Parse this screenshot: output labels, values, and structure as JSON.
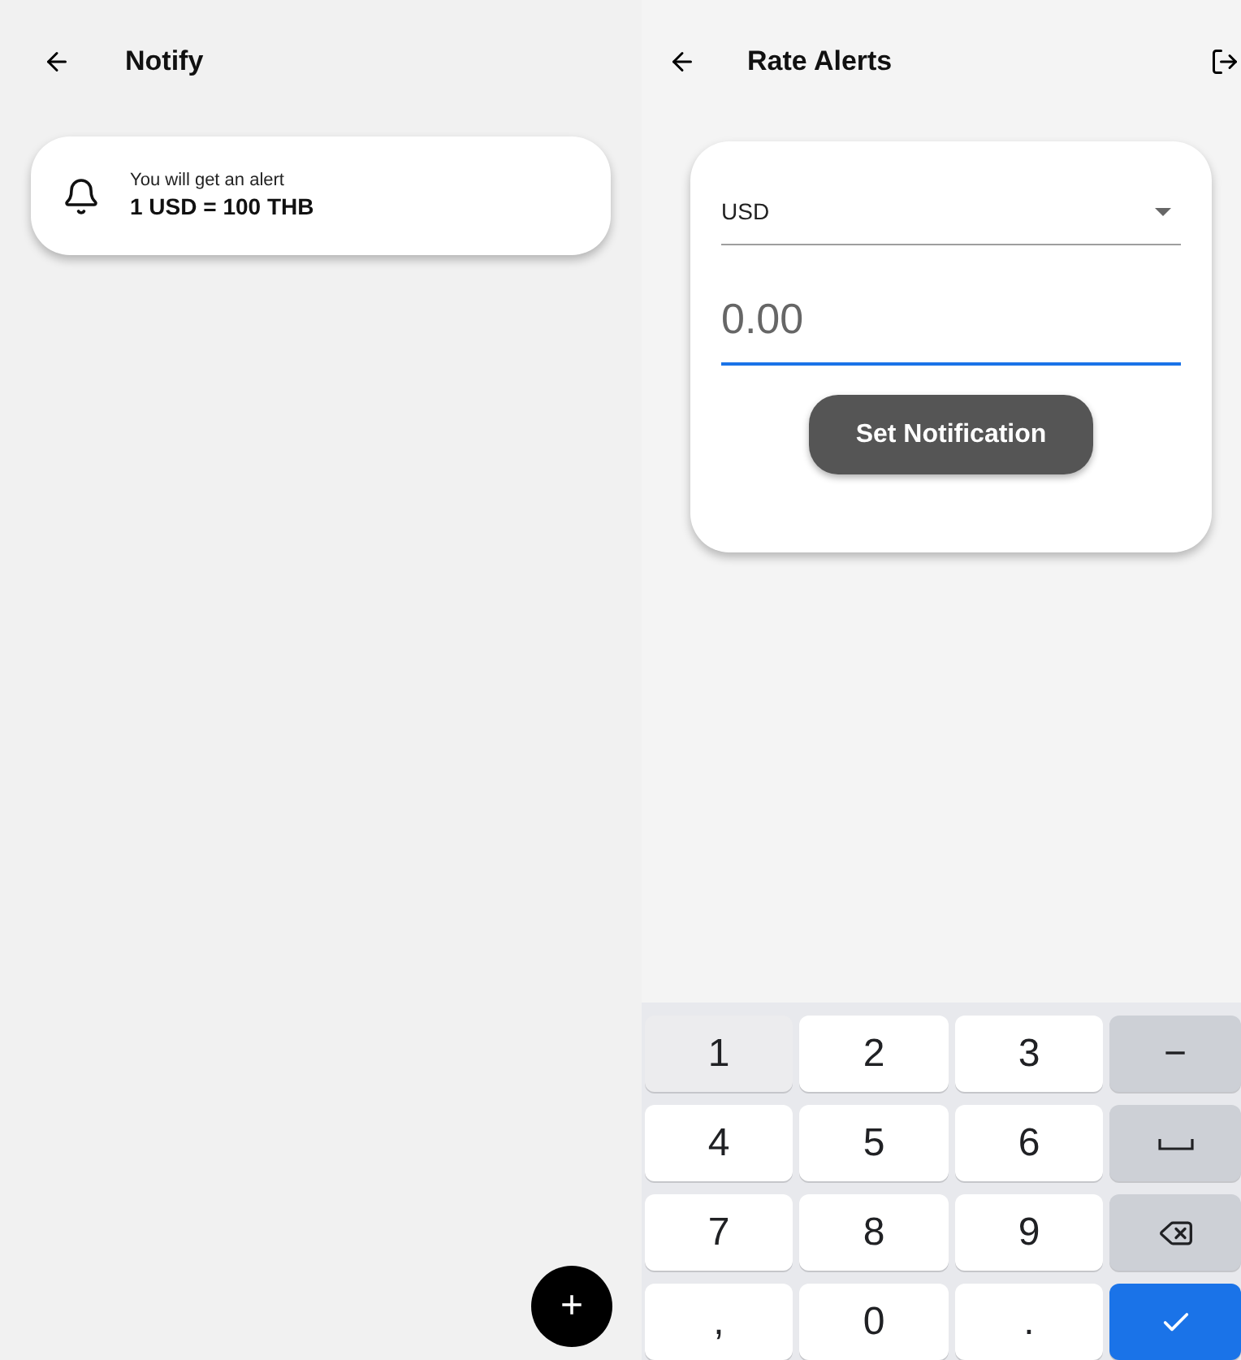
{
  "notify_screen": {
    "title": "Notify",
    "alerts": [
      {
        "caption": "You will get an alert",
        "rate": "1 USD = 100 THB"
      }
    ],
    "add_button": {
      "label": "+"
    }
  },
  "rate_alerts_screen": {
    "title": "Rate Alerts",
    "currency_dropdown": {
      "value": "USD"
    },
    "amount_field": {
      "placeholder": "0.00",
      "focused": true
    },
    "set_button": {
      "label": "Set Notification"
    }
  },
  "keyboard": {
    "keys": [
      {
        "kind": "char",
        "label": "1",
        "pressed": true
      },
      {
        "kind": "char",
        "label": "2",
        "pressed": false
      },
      {
        "kind": "char",
        "label": "3",
        "pressed": false
      },
      {
        "kind": "symbol",
        "label": "−",
        "pressed": false
      },
      {
        "kind": "char",
        "label": "4",
        "pressed": false
      },
      {
        "kind": "char",
        "label": "5",
        "pressed": false
      },
      {
        "kind": "char",
        "label": "6",
        "pressed": false
      },
      {
        "kind": "space",
        "pressed": false
      },
      {
        "kind": "char",
        "label": "7",
        "pressed": false
      },
      {
        "kind": "char",
        "label": "8",
        "pressed": false
      },
      {
        "kind": "char",
        "label": "9",
        "pressed": false
      },
      {
        "kind": "backspace",
        "pressed": false
      },
      {
        "kind": "char",
        "label": ",",
        "pressed": false
      },
      {
        "kind": "char",
        "label": "0",
        "pressed": false
      },
      {
        "kind": "char",
        "label": ".",
        "pressed": false
      },
      {
        "kind": "done",
        "pressed": false
      }
    ]
  }
}
